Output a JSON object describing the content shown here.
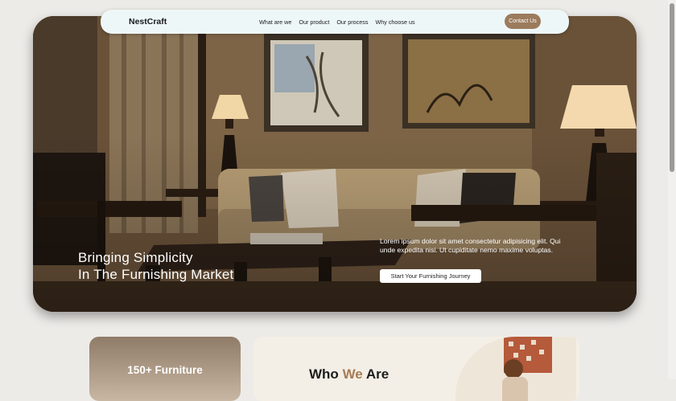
{
  "nav": {
    "brand": "NestCraft",
    "links": [
      "What are we",
      "Our product",
      "Our process",
      "Why choose us"
    ],
    "cta": "Contact Us"
  },
  "hero": {
    "headline_line1": "Bringing Simplicity",
    "headline_line2": "In The Furnishing Market",
    "description": "Lorem ipsum dolor sit amet consectetur adipisicing elit. Qui unde expedita nisi. Ut cupiditate nemo maxime voluptas.",
    "cta": "Start Your Furnishing Journey"
  },
  "stats": {
    "furniture_count": "150+ Furniture"
  },
  "about": {
    "title_prefix": "Who",
    "title_accent": "We",
    "title_suffix": "Are"
  },
  "colors": {
    "accent": "#9c7b5d",
    "accent_text": "#a77b55",
    "nav_background": "#eef7f8",
    "page_background": "#edebe8"
  }
}
